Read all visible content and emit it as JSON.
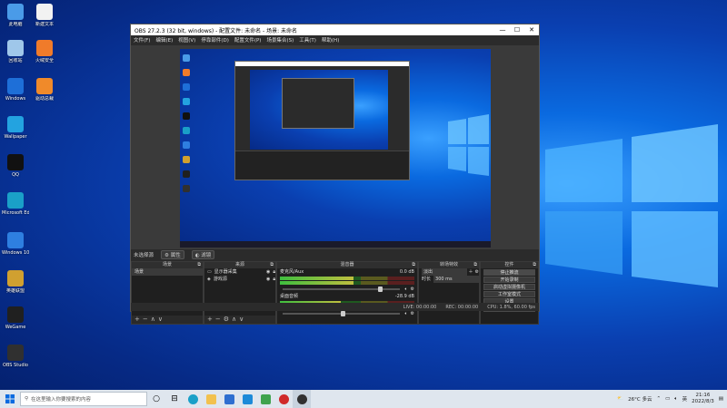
{
  "desktop": {
    "icons": [
      {
        "label": "此电脑",
        "color": "#4a9be8"
      },
      {
        "label": "新建文本",
        "color": "#f2f2f2"
      },
      {
        "label": "回收站",
        "color": "#9fc7ea"
      },
      {
        "label": "火绒安全",
        "color": "#f07b2a"
      },
      {
        "label": "Windows",
        "color": "#1e6fd8"
      },
      {
        "label": "驱动总裁",
        "color": "#f08a2a"
      },
      {
        "label": "Wallpaper",
        "color": "#23a3e0"
      },
      {
        "label": "QQ",
        "color": "#111111"
      },
      {
        "label": "Microsoft Edge",
        "color": "#1aa0c8"
      },
      {
        "label": "Windows 10 助手",
        "color": "#2e7fe0"
      },
      {
        "label": "英雄联盟",
        "color": "#d0a030"
      },
      {
        "label": "WeGame",
        "color": "#202020"
      },
      {
        "label": "OBS Studio",
        "color": "#303030"
      }
    ]
  },
  "obs": {
    "title": "OBS 27.2.3 (32 bit, windows) - 配置文件: 未命名 - 场景: 未命名",
    "window_controls": {
      "minimize": "—",
      "maximize": "☐",
      "close": "✕"
    },
    "menu": [
      "文件(F)",
      "编辑(E)",
      "视图(V)",
      "停靠部件(D)",
      "配置文件(P)",
      "场景集合(S)",
      "工具(T)",
      "帮助(H)"
    ],
    "source_bar": {
      "label": "未选择源",
      "properties": "属性",
      "filters": "滤镜"
    },
    "docks": {
      "scenes": {
        "title": "场景",
        "items": [
          "场景"
        ]
      },
      "sources": {
        "title": "来源",
        "items": [
          "显示器采集",
          "游戏源"
        ]
      },
      "mixer": {
        "title": "混音器",
        "tracks": [
          {
            "name": "麦克风/Aux",
            "db": "0.0 dB",
            "level": 0.55,
            "volume": 0.82
          },
          {
            "name": "桌面音频",
            "db": "-28.9 dB",
            "level": 0.45,
            "volume": 0.5
          }
        ],
        "scale": "-60 -55 -50 -45 -40 -35 -30 -25 -20 -15 -10 -5 0"
      },
      "transitions": {
        "title": "转场特效",
        "type": "淡出",
        "duration_label": "时长",
        "duration": "300 ms"
      },
      "controls": {
        "title": "控件",
        "buttons": [
          "停止推流",
          "开始录制",
          "启动虚拟摄像机",
          "工作室模式",
          "设置",
          "退出"
        ]
      }
    },
    "status": {
      "live": "LIVE: 00:00:00",
      "rec": "REC: 00:00:00",
      "cpu": "CPU: 1.8%, 60.00 fps"
    }
  },
  "taskbar": {
    "search_placeholder": "在这里输入你要搜索的内容",
    "weather": "26°C 多云",
    "lang": "英",
    "time": "21:16",
    "date": "2022/8/3"
  },
  "colors": {
    "obs_bg": "#2b2b2b",
    "accent_blue": "#0a6ae0",
    "taskbar": "#dfe6ee"
  }
}
